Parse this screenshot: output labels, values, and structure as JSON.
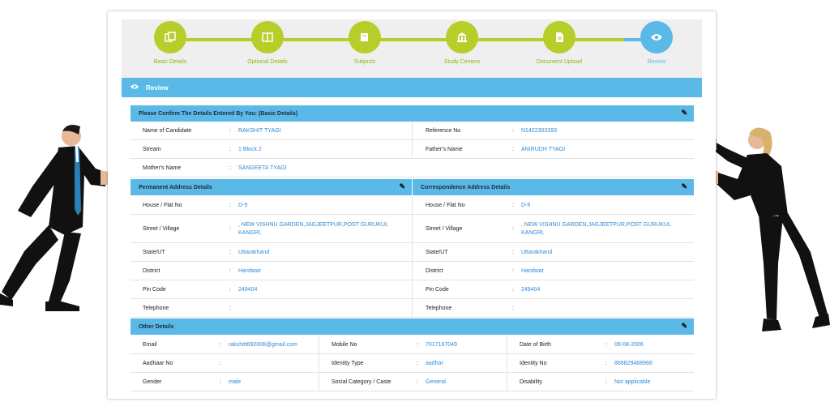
{
  "stepper": {
    "steps": [
      {
        "label": "Basic Details",
        "icon": "copy-icon"
      },
      {
        "label": "Optional Details",
        "icon": "columns-icon"
      },
      {
        "label": "Subjects",
        "icon": "book-icon"
      },
      {
        "label": "Study Centers",
        "icon": "building-icon"
      },
      {
        "label": "Document Upload",
        "icon": "document-icon"
      },
      {
        "label": "Review",
        "icon": "eye-icon"
      }
    ],
    "colors": {
      "completed": "#b7ce2a",
      "active": "#5bb9e8"
    }
  },
  "review_header": {
    "title": "Review"
  },
  "basic": {
    "title": "Please Confirm The Details Entered By You: (Basic Details)",
    "name_label": "Name of Candidate",
    "name_value": "RAKSHIT TYAGI",
    "ref_label": "Reference No",
    "ref_value": "N1422303393",
    "stream_label": "Stream",
    "stream_value": "1 Block 2",
    "father_label": "Father's Name",
    "father_value": "ANIRUDH TYAGI",
    "mother_label": "Mother's Name",
    "mother_value": "SANGEETA TYAGI"
  },
  "permanent": {
    "title": "Permanent Address Details",
    "house_label": "House / Flat No",
    "house_value": "D-9",
    "street_label": "Street / Village",
    "street_value": ", NEW VISHNU GARDEN,JAGJEETPUR,POST GURUKUL KANGRI,",
    "state_label": "State/UT",
    "state_value": "Uttarakhand",
    "district_label": "District",
    "district_value": "Haridwar",
    "pin_label": "Pin Code",
    "pin_value": "249404",
    "tel_label": "Telephone",
    "tel_value": ""
  },
  "correspondence": {
    "title": "Correspondence Address Details",
    "house_label": "House / Flat No",
    "house_value": "D-9",
    "street_label": "Street / Village",
    "street_value": ", NEW VISHNU GARDEN,JAGJEETPUR,POST GURUKUL KANGRI,",
    "state_label": "State/UT",
    "state_value": "Uttarakhand",
    "district_label": "District",
    "district_value": "Haridwar",
    "pin_label": "Pin Code",
    "pin_value": "249404",
    "tel_label": "Telephone",
    "tel_value": ""
  },
  "other": {
    "title": "Other Details",
    "email_label": "Email",
    "email_value": "rakshitt892006@gmail.com",
    "mobile_label": "Mobile No",
    "mobile_value": "7017167049",
    "dob_label": "Date of Birth",
    "dob_value": "09-08-2006",
    "aadhaar_label": "Aadhaar No",
    "aadhaar_value": "",
    "idtype_label": "Identity Type",
    "idtype_value": "aadhar",
    "idno_label": "Identity No",
    "idno_value": "866829468968",
    "gender_label": "Gender",
    "gender_value": "male",
    "social_label": "Social Category / Caste",
    "social_value": "General",
    "disability_label": "Disability",
    "disability_value": "Not applicable"
  },
  "colors": {
    "accent": "#5bb9e8",
    "value_text": "#2f8ad6",
    "completed_step": "#b7ce2a"
  }
}
